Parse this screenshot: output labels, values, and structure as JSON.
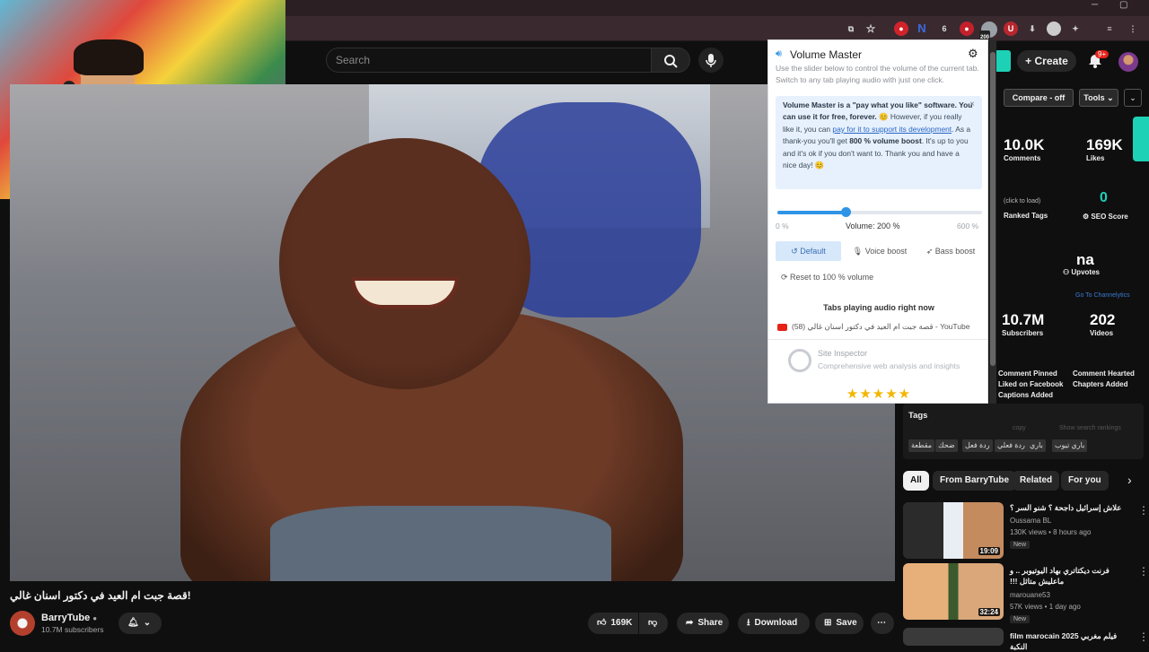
{
  "extensions": {
    "badge_count": "200"
  },
  "search": {
    "placeholder": "Search"
  },
  "header": {
    "create_label": "Create",
    "notif_badge": "9+"
  },
  "video": {
    "title": "!قصة جبت ام العيد في دكتور اسنان غالي",
    "channel": "BarryTube",
    "subscribers": "10.7M subscribers",
    "likes": "169K",
    "share_label": "Share",
    "download_label": "Download",
    "save_label": "Save"
  },
  "volume_master": {
    "title": "Volume Master",
    "subtitle": "Use the slider below to control the volume of the current tab. Switch to any tab playing audio with just one click.",
    "note_bold1": "Volume Master is a \"pay what you like\" software. You can use it for free, forever.",
    "note_text1": "However, if you really like it, you can",
    "note_link": "pay for it to support its development",
    "note_text2": ". As a thank-you you'll get",
    "note_bold2": "800 % volume boost",
    "note_text3": ". It's up to you and it's ok if you don't want to. Thank you and have a nice day!",
    "min_label": "0 %",
    "max_label": "600 %",
    "volume_label": "Volume: 200 %",
    "volume_fraction": 0.333,
    "default_label": "Default",
    "voice_label": "Voice boost",
    "bass_label": "Bass boost",
    "reset_label": "Reset to 100 % volume",
    "tabs_heading": "Tabs playing audio right now",
    "tab_item": "(58) قصة جبت ام العيد في دكتور اسنان غالي - YouTube",
    "site_inspector_title": "Site Inspector",
    "site_inspector_sub": "Comprehensive web analysis and insights",
    "stars": "★★★★★"
  },
  "panel": {
    "compare_label": "Compare - off",
    "tools_label": "Tools",
    "comments_value": "10.0K",
    "comments_label": "Comments",
    "likes_value": "169K",
    "likes_label": "Likes",
    "click_to_load": "(click to load)",
    "ranked_tags": "Ranked Tags",
    "seo_value": "0",
    "seo_label": "SEO Score",
    "upvotes_value": "na",
    "upvotes_label": "Upvotes",
    "channelytics": "Go To Channelytics",
    "subscribers_value": "10.7M",
    "subscribers_label": "Subscribers",
    "videos_value": "202",
    "videos_label": "Videos",
    "flags": [
      "Comment Pinned",
      "Comment Hearted",
      "Liked on Facebook",
      "Chapters Added",
      "Captions Added"
    ]
  },
  "tags": {
    "heading": "Tags",
    "copy": "copy",
    "show_rankings": "Show search rankings",
    "items": [
      "باري تيوب",
      "باري",
      "ردة فعلي",
      "ردة فعل",
      "ضحك",
      "مقطعة"
    ]
  },
  "chips": [
    "All",
    "From BarryTube",
    "Related",
    "For you"
  ],
  "recommendations": [
    {
      "title": "علاش إسرائيل داجحة ؟ شنو السر ؟",
      "channel": "Oussama BL",
      "meta": "130K views • 8 hours ago",
      "duration": "19:09",
      "badge": "New"
    },
    {
      "title": "فرنت ديكتاتري بهاد اليوتيوبر .. و ماعليش متاثل !!!",
      "channel": "marouane53",
      "meta": "57K views • 1 day ago",
      "duration": "32:24",
      "badge": "New"
    },
    {
      "title": "film marocain فيلم مغربي 2025 النكبة",
      "channel": "",
      "meta": "",
      "duration": "",
      "badge": ""
    }
  ]
}
